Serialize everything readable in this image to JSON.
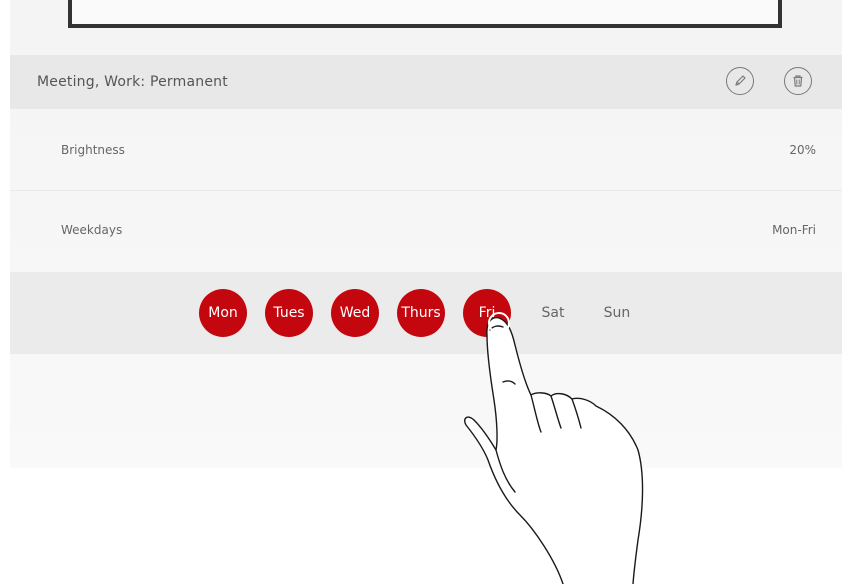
{
  "schedule": {
    "title": "Meeting, Work: Permanent"
  },
  "actions": {
    "edit_icon": "pencil-icon",
    "delete_icon": "trash-icon"
  },
  "settings": {
    "brightness_label": "Brightness",
    "brightness_value": "20%",
    "weekdays_label": "Weekdays",
    "weekdays_value": "Mon-Fri"
  },
  "days": [
    {
      "label": "Mon",
      "selected": true
    },
    {
      "label": "Tues",
      "selected": true
    },
    {
      "label": "Wed",
      "selected": true
    },
    {
      "label": "Thurs",
      "selected": true
    },
    {
      "label": "Fri",
      "selected": true
    },
    {
      "label": "Sat",
      "selected": false
    },
    {
      "label": "Sun",
      "selected": false
    }
  ],
  "colors": {
    "accent": "#c4070e",
    "header_background": "#e8e8e8",
    "day_row_background": "#ebebeb",
    "text": "#666666"
  }
}
